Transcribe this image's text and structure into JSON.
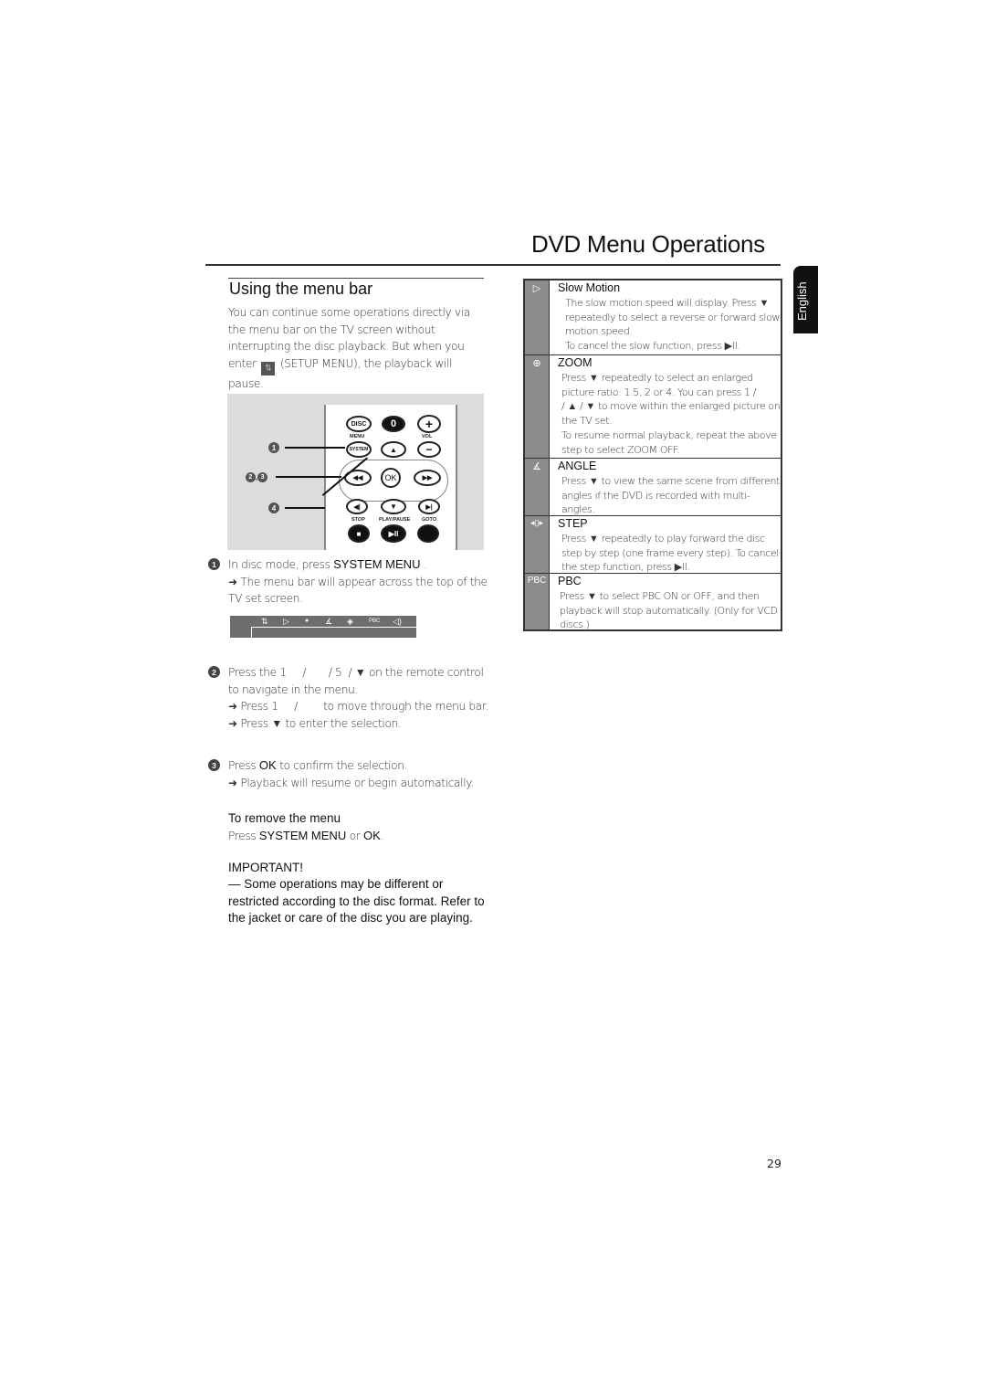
{
  "page": {
    "title": "DVD Menu Operations",
    "language_tab": "English",
    "page_number": "29"
  },
  "section": {
    "title": "Using the menu bar",
    "intro_part1": "You can continue some operations directly via the menu bar on the TV screen without interrupting the disc playback. But when you enter",
    "intro_setup_icon": "setup-menu-icon",
    "intro_part2": "(SETUP MENU), the playback will pause."
  },
  "remote": {
    "buttons": {
      "disc": "DISC",
      "zero": "0",
      "vol_plus": "+",
      "menu": "MENU",
      "vol": "VOL",
      "system": "SYSTEM",
      "up": "▲",
      "vol_minus": "−",
      "rewind": "◀◀",
      "ok": "OK",
      "forward": "▶▶",
      "prev": "◀|",
      "down": "▼",
      "next": "▶|",
      "stop_label": "STOP",
      "play_pause_label": "PLAY/PAUSE",
      "goto_label": "GOTO",
      "stop": "■",
      "play_pause": "▶II"
    },
    "callouts": [
      "1",
      "2, 3",
      "4"
    ]
  },
  "steps": [
    {
      "number": "1",
      "text_prefix": "In disc mode, press",
      "key": "SYSTEM MENU",
      "text_suffix": ".",
      "results": [
        "➜ The menu bar will appear across the top of the TV set screen."
      ]
    },
    {
      "number": "2",
      "line1": "Press the 1     /       / 5  / ▼ on the remote control to navigate in the menu.",
      "results": [
        "➜ Press 1     /        to move through the menu bar.",
        "➜ Press ▼ to enter the selection."
      ]
    },
    {
      "number": "3",
      "text_prefix": "Press",
      "key": "OK",
      "text_suffix": "to confirm the selection.",
      "results": [
        "➜ Playback will resume or begin automatically."
      ]
    }
  ],
  "menubar": {
    "icons": [
      "setup-icon",
      "slow-motion-icon",
      "zoom-icon",
      "angle-icon",
      "step-icon",
      "pbc-icon",
      "audio-icon"
    ],
    "glyphs": [
      "⇅",
      "▷",
      "●",
      "∡",
      "◈",
      "PBC",
      "◁)"
    ]
  },
  "remove_menu": {
    "heading": "To  remove the menu",
    "press": "Press",
    "key1": "SYSTEM MENU",
    "or": "or",
    "key2": "OK",
    "end": "."
  },
  "important": {
    "heading": "IMPORTANT!",
    "text": "— Some operations may be different or restricted according to the disc format. Refer to the jacket or care of the disc you are playing."
  },
  "features": [
    {
      "icon": "slow-motion-icon",
      "glyph": "▷",
      "title": "Slow Motion",
      "body": "The slow motion speed will display. Press ▼ repeatedly to select a reverse or forward slow motion speed.\nTo cancel the slow function, press ▶II."
    },
    {
      "icon": "zoom-icon",
      "glyph": "⊕",
      "title": "ZOOM",
      "body": "Press ▼ repeatedly to select an enlarged picture ratio: 1.5, 2 or 4.  You can press 1      /\n        /  ▲  /  ▼ to move within the enlarged picture on the TV set.\nTo resume normal playback, repeat the above step to select ZOOM OFF."
    },
    {
      "icon": "angle-icon",
      "glyph": "∡",
      "title": "ANGLE",
      "body": "Press ▼ to view the same scene from different angles  if the DVD is recorded with multi-angles."
    },
    {
      "icon": "step-icon",
      "glyph": "◂▯▸",
      "title": "STEP",
      "body": "Press ▼ repeatedly to play forward the disc step by step (one frame every step). To cancel the step function, press ▶II."
    },
    {
      "icon": "pbc-icon",
      "glyph": "PBC",
      "title": "PBC",
      "body": "Press ▼ to select PBC ON or OFF, and then playback will stop automatically.  (Only for VCD discs.)"
    }
  ]
}
